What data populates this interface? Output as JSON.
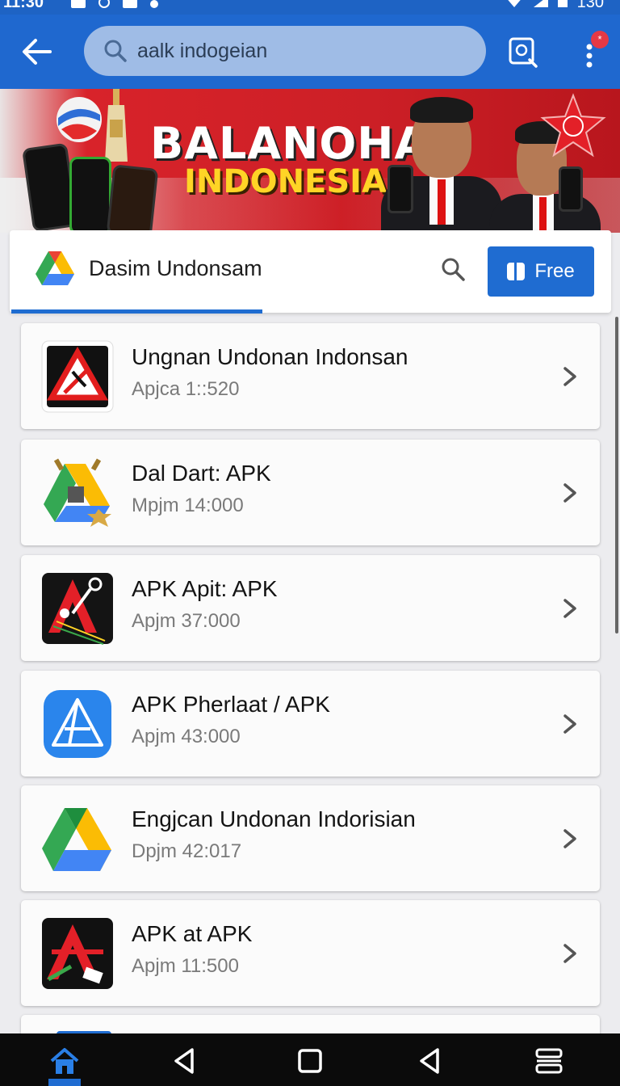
{
  "status_bar": {
    "time": "11:30",
    "battery": "130"
  },
  "search": {
    "value": "aalk indogeian"
  },
  "header": {
    "notification_badge": "*"
  },
  "banner": {
    "title": "BALANOHAN",
    "subtitle": "INDONESIA"
  },
  "tab": {
    "title": "Dasim Undonsam",
    "button_label": "Free"
  },
  "apps": [
    {
      "name": "Ungnan Undonan Indonsan",
      "meta": "Apjca 1::520",
      "icon": "red-warning-triangle-icon"
    },
    {
      "name": "Dal Dart: APK",
      "meta": "Mpjm 14:000",
      "icon": "drive-triangle-icon"
    },
    {
      "name": "APK Apit: APK",
      "meta": "Apjm 37:000",
      "icon": "apk-tool-icon"
    },
    {
      "name": "APK Pherlaat / APK",
      "meta": "Apjm 43:000",
      "icon": "blue-a-icon"
    },
    {
      "name": "Engjcan Undonan Indorisian",
      "meta": "Dpjm 42:017",
      "icon": "drive-icon"
    },
    {
      "name": "APK at APK",
      "meta": "Apjm 11:500",
      "icon": "red-a-icon"
    }
  ],
  "colors": {
    "primary": "#1f68cf",
    "banner_red": "#cc1f26",
    "accent_yellow": "#ffd426"
  }
}
